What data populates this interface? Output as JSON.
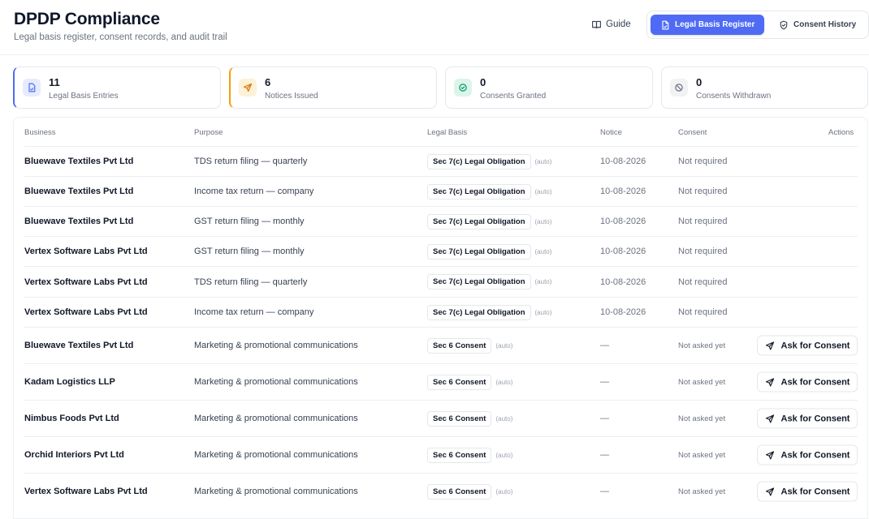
{
  "header": {
    "title": "DPDP Compliance",
    "subtitle": "Legal basis register, consent records, and audit trail",
    "guide_label": "Guide",
    "tabs": [
      {
        "label": "Legal Basis Register",
        "active": true
      },
      {
        "label": "Consent History",
        "active": false
      }
    ]
  },
  "stats": [
    {
      "value": "11",
      "label": "Legal Basis Entries",
      "accent": "#4f6bf5",
      "icon": "document-icon"
    },
    {
      "value": "6",
      "label": "Notices Issued",
      "accent": "#f59e0b",
      "icon": "send-icon"
    },
    {
      "value": "0",
      "label": "Consents Granted",
      "accent": "#10b981",
      "icon": "check-circle-icon"
    },
    {
      "value": "0",
      "label": "Consents Withdrawn",
      "accent": "#9ca3af",
      "icon": "ban-icon"
    }
  ],
  "table": {
    "columns": {
      "business": "Business",
      "purpose": "Purpose",
      "basis": "Legal Basis",
      "notice": "Notice",
      "consent": "Consent",
      "actions": "Actions"
    },
    "ask_label": "Ask for Consent",
    "rows": [
      {
        "business": "Bluewave Textiles Pvt Ltd",
        "purpose": "TDS return filing — quarterly",
        "basis": "Sec 7(c) Legal Obligation",
        "auto": "(auto)",
        "notice": "10-08-2026",
        "consent": "Not required"
      },
      {
        "business": "Bluewave Textiles Pvt Ltd",
        "purpose": "Income tax return — company",
        "basis": "Sec 7(c) Legal Obligation",
        "auto": "(auto)",
        "notice": "10-08-2026",
        "consent": "Not required"
      },
      {
        "business": "Bluewave Textiles Pvt Ltd",
        "purpose": "GST return filing — monthly",
        "basis": "Sec 7(c) Legal Obligation",
        "auto": "(auto)",
        "notice": "10-08-2026",
        "consent": "Not required"
      },
      {
        "business": "Vertex Software Labs Pvt Ltd",
        "purpose": "GST return filing — monthly",
        "basis": "Sec 7(c) Legal Obligation",
        "auto": "(auto)",
        "notice": "10-08-2026",
        "consent": "Not required"
      },
      {
        "business": "Vertex Software Labs Pvt Ltd",
        "purpose": "TDS return filing — quarterly",
        "basis": "Sec 7(c) Legal Obligation",
        "auto": "(auto)",
        "notice": "10-08-2026",
        "consent": "Not required"
      },
      {
        "business": "Vertex Software Labs Pvt Ltd",
        "purpose": "Income tax return — company",
        "basis": "Sec 7(c) Legal Obligation",
        "auto": "(auto)",
        "notice": "10-08-2026",
        "consent": "Not required"
      },
      {
        "business": "Bluewave Textiles Pvt Ltd",
        "purpose": "Marketing & promotional communications",
        "basis": "Sec 6 Consent",
        "auto": "(auto)",
        "notice": "—",
        "consent": "Not asked yet"
      },
      {
        "business": "Kadam Logistics LLP",
        "purpose": "Marketing & promotional communications",
        "basis": "Sec 6 Consent",
        "auto": "(auto)",
        "notice": "—",
        "consent": "Not asked yet"
      },
      {
        "business": "Nimbus Foods Pvt Ltd",
        "purpose": "Marketing & promotional communications",
        "basis": "Sec 6 Consent",
        "auto": "(auto)",
        "notice": "—",
        "consent": "Not asked yet"
      },
      {
        "business": "Orchid Interiors Pvt Ltd",
        "purpose": "Marketing & promotional communications",
        "basis": "Sec 6 Consent",
        "auto": "(auto)",
        "notice": "—",
        "consent": "Not asked yet"
      },
      {
        "business": "Vertex Software Labs Pvt Ltd",
        "purpose": "Marketing & promotional communications",
        "basis": "Sec 6 Consent",
        "auto": "(auto)",
        "notice": "—",
        "consent": "Not asked yet"
      }
    ]
  }
}
